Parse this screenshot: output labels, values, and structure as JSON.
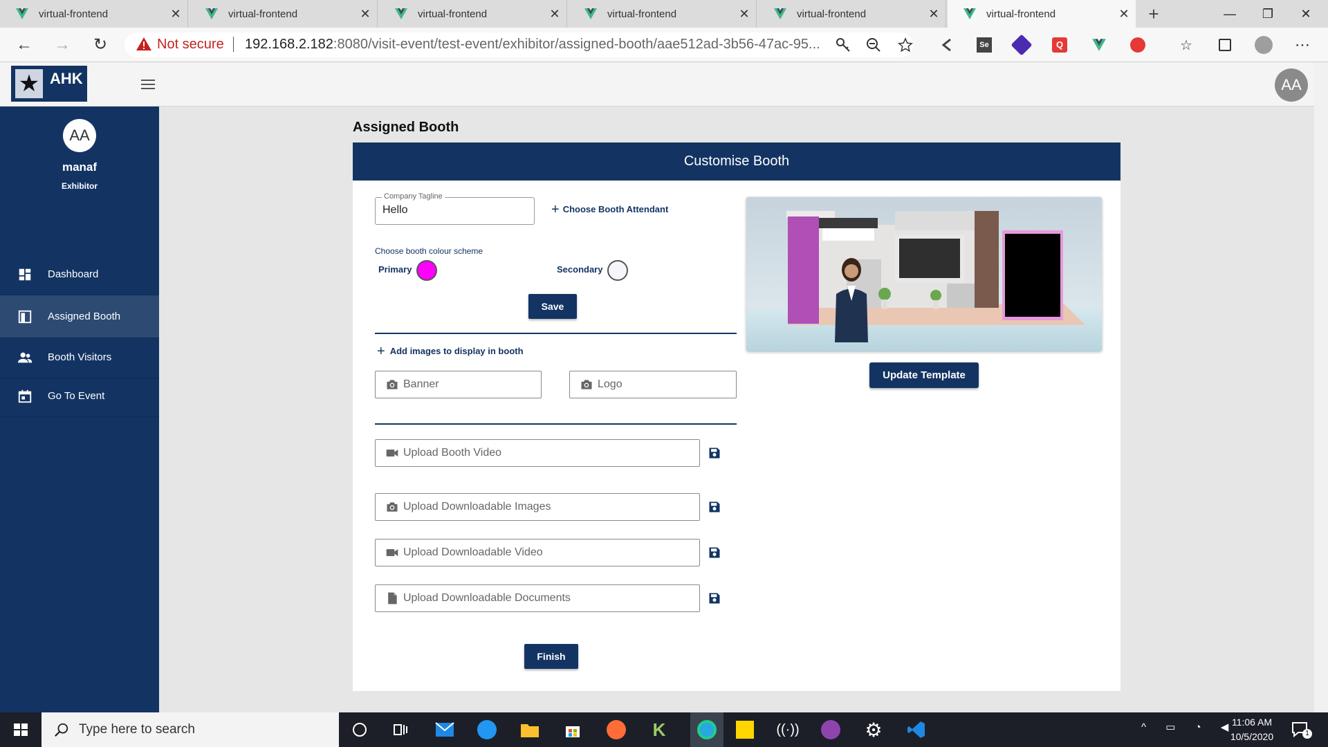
{
  "browser": {
    "tabs": [
      {
        "title": "virtual-frontend",
        "active": false
      },
      {
        "title": "virtual-frontend",
        "active": false
      },
      {
        "title": "virtual-frontend",
        "active": false
      },
      {
        "title": "virtual-frontend",
        "active": false
      },
      {
        "title": "virtual-frontend",
        "active": false
      },
      {
        "title": "virtual-frontend",
        "active": true
      }
    ],
    "security_label": "Not secure",
    "url_host": "192.168.2.182",
    "url_rest": ":8080/visit-event/test-event/exhibitor/assigned-booth/aae512ad-3b56-47ac-95..."
  },
  "app": {
    "logo_text": "AHK",
    "avatar_initials": "AA"
  },
  "sidebar": {
    "avatar_initials": "AA",
    "user_name": "manaf",
    "user_role": "Exhibitor",
    "items": [
      {
        "label": "Dashboard",
        "icon": "dashboard-icon",
        "active": false
      },
      {
        "label": "Assigned Booth",
        "icon": "booth-icon",
        "active": true
      },
      {
        "label": "Booth Visitors",
        "icon": "people-icon",
        "active": false
      },
      {
        "label": "Go To Event",
        "icon": "calendar-icon",
        "active": false
      }
    ]
  },
  "main": {
    "page_title": "Assigned Booth",
    "card_title": "Customise Booth",
    "tagline": {
      "label": "Company Tagline",
      "value": "Hello"
    },
    "choose_attendant": "Choose Booth Attendant",
    "colour_scheme_label": "Choose booth colour scheme",
    "primary_label": "Primary",
    "primary_color": "#ff00ff",
    "secondary_label": "Secondary",
    "secondary_color": "#f7f4fb",
    "save_label": "Save",
    "add_images_label": "Add images to display in booth",
    "banner_placeholder": "Banner",
    "logo_placeholder": "Logo",
    "uploads": [
      {
        "placeholder": "Upload Booth Video",
        "icon": "video-icon"
      },
      {
        "placeholder": "Upload Downloadable Images",
        "icon": "camera-icon"
      },
      {
        "placeholder": "Upload Downloadable Video",
        "icon": "video-icon"
      },
      {
        "placeholder": "Upload Downloadable Documents",
        "icon": "document-icon"
      }
    ],
    "finish_label": "Finish",
    "update_template_label": "Update Template"
  },
  "taskbar": {
    "search_placeholder": "Type here to search",
    "time": "11:06 AM",
    "date": "10/5/2020",
    "notification_count": "1"
  },
  "colors": {
    "brand": "#133463",
    "sidebar_active": "#2d4a72",
    "background": "#e6e6e6"
  }
}
